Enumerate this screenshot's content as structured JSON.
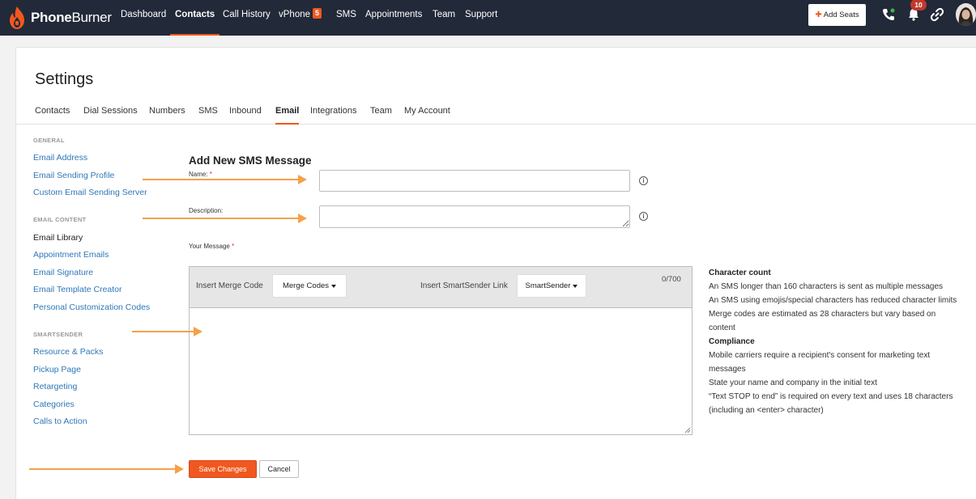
{
  "brand": {
    "name_bold": "Phone",
    "name_thin": "Burner"
  },
  "nav": {
    "items": [
      {
        "label": "Dashboard"
      },
      {
        "label": "Contacts"
      },
      {
        "label": "Call History"
      },
      {
        "label": "vPhone",
        "badge": "5"
      },
      {
        "label": "SMS"
      },
      {
        "label": "Appointments"
      },
      {
        "label": "Team"
      },
      {
        "label": "Support"
      }
    ],
    "active": "Contacts",
    "add_seats_label": "Add Seats",
    "notification_count": "10"
  },
  "page": {
    "title": "Settings"
  },
  "tabs": [
    {
      "label": "Contacts"
    },
    {
      "label": "Dial Sessions"
    },
    {
      "label": "Numbers"
    },
    {
      "label": "SMS"
    },
    {
      "label": "Inbound"
    },
    {
      "label": "Email"
    },
    {
      "label": "Integrations"
    },
    {
      "label": "Team"
    },
    {
      "label": "My Account"
    }
  ],
  "active_tab": "Email",
  "sidebar": {
    "sections": [
      {
        "heading": "GENERAL",
        "items": [
          "Email Address",
          "Email Sending Profile",
          "Custom Email Sending Server"
        ]
      },
      {
        "heading": "EMAIL CONTENT",
        "items": [
          "Email Library",
          "Appointment Emails",
          "Email Signature",
          "Email Template Creator",
          "Personal Customization Codes"
        ]
      },
      {
        "heading": "SMARTSENDER",
        "items": [
          "Resource & Packs",
          "Pickup Page",
          "Retargeting",
          "Categories",
          "Calls to Action"
        ]
      }
    ],
    "current": "Email Library"
  },
  "form": {
    "title": "Add New SMS Message",
    "name_label": "Name:",
    "name_value": "",
    "description_label": "Description:",
    "description_value": "",
    "message_label": "Your Message",
    "message_value": "",
    "insert_merge_label": "Insert Merge Code",
    "merge_codes_button": "Merge Codes",
    "insert_smartsender_label": "Insert SmartSender Link",
    "smartsender_button": "SmartSender",
    "char_counter": "0/700",
    "save_label": "Save Changes",
    "cancel_label": "Cancel"
  },
  "info": {
    "char_heading": "Character count",
    "char_lines": [
      "An SMS longer than 160 characters is sent as multiple messages",
      "An SMS using emojis/special characters has reduced character limits",
      "Merge codes are estimated as 28 characters but vary based on content"
    ],
    "compliance_heading": "Compliance",
    "compliance_lines": [
      "Mobile carriers require a recipient's consent for marketing text messages",
      "State your name and company in the initial text",
      "“Text STOP to end” is required on every text and uses 18 characters (including an <enter> character)"
    ]
  },
  "colors": {
    "accent": "#f0581f",
    "navbar": "#222938",
    "link": "#2f77b8",
    "annotation_arrow": "#f5a14a"
  }
}
